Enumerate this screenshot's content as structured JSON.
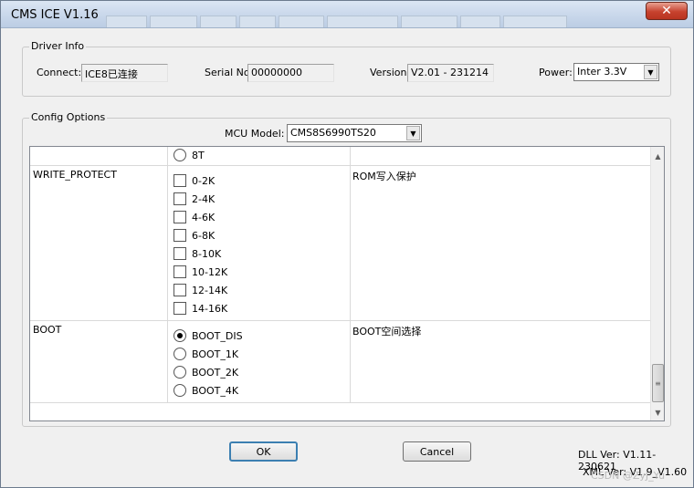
{
  "window": {
    "title": "CMS ICE V1.16",
    "close_label": "✕"
  },
  "driver_info": {
    "group_label": "Driver Info",
    "connect_label": "Connect:",
    "connect_value": "ICE8已连接",
    "serial_label": "Serial No:",
    "serial_value": "00000000",
    "version_label": "Version:",
    "version_value": "V2.01 - 231214",
    "power_label": "Power:",
    "power_value": "Inter 3.3V"
  },
  "config": {
    "group_label": "Config Options",
    "mcu_label": "MCU Model:",
    "mcu_value": "CMS8S6990TS20"
  },
  "grid": {
    "partial_option": "8T",
    "write_protect": {
      "name": "WRITE_PROTECT",
      "description": "ROM写入保护",
      "options": [
        "0-2K",
        "2-4K",
        "4-6K",
        "6-8K",
        "8-10K",
        "10-12K",
        "12-14K",
        "14-16K"
      ]
    },
    "boot": {
      "name": "BOOT",
      "description": "BOOT空间选择",
      "options": [
        "BOOT_DIS",
        "BOOT_1K",
        "BOOT_2K",
        "BOOT_4K"
      ],
      "selected": "BOOT_DIS"
    }
  },
  "buttons": {
    "ok": "OK",
    "cancel": "Cancel"
  },
  "versions": {
    "dll": "DLL Ver: V1.11-230621",
    "xml": "XML Ver: V1.9_V1.60"
  },
  "watermark": "CSDN @ZyJ_Yu"
}
